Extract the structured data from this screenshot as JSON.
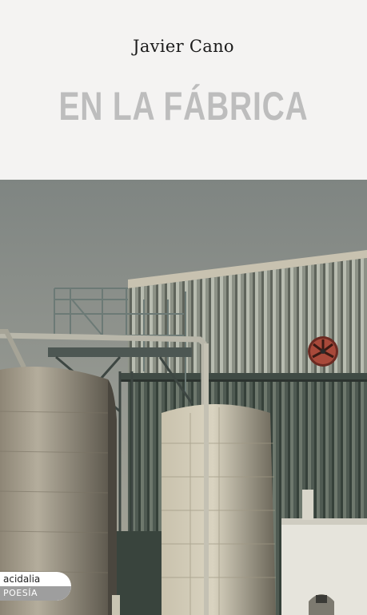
{
  "cover": {
    "author": "Javier Cano",
    "title": "EN LA FÁBRICA"
  },
  "publisher_badge": {
    "imprint": "acidalia",
    "collection": "POESÍA"
  },
  "colors": {
    "background": "#f4f3f2",
    "title": "#bdbdbd",
    "sky": "#8b8f8a",
    "badge_band": "#9e9e9e"
  }
}
